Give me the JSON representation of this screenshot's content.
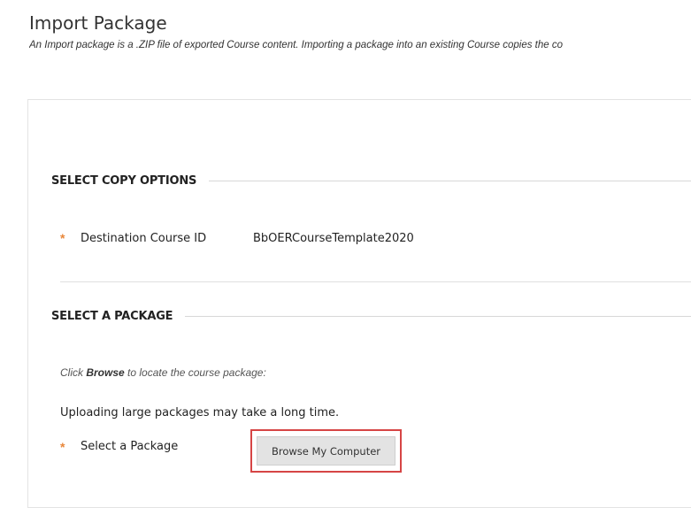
{
  "page": {
    "title": "Import Package",
    "description": "An Import package is a .ZIP file of exported Course content. Importing a package into an existing Course copies the co"
  },
  "copy_options": {
    "heading": "SELECT COPY OPTIONS",
    "destination_label": "Destination Course ID",
    "destination_value": "BbOERCourseTemplate2020",
    "required_marker": "*"
  },
  "package": {
    "heading": "SELECT A PACKAGE",
    "hint_prefix": "Click ",
    "hint_bold": "Browse",
    "hint_suffix": " to locate the course package:",
    "note": "Uploading large packages may take a long time.",
    "select_label": "Select a Package",
    "required_marker": "*",
    "browse_label": "Browse My Computer"
  },
  "colors": {
    "required": "#e8873a",
    "highlight_border": "#d64545"
  }
}
